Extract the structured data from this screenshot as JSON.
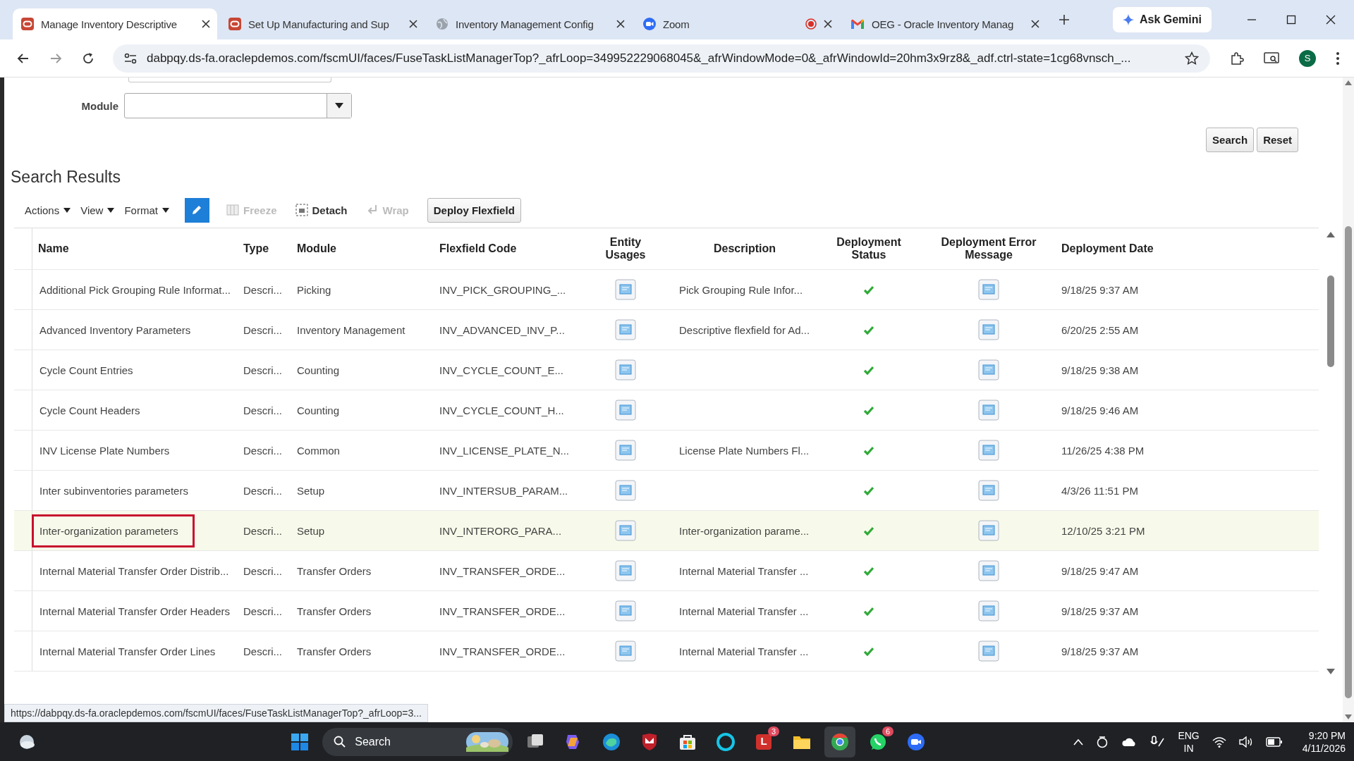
{
  "browser": {
    "tabs": [
      {
        "title": "Manage Inventory Descriptive",
        "kind": "oracle",
        "selected": true,
        "recording": false
      },
      {
        "title": "Set Up Manufacturing and Sup",
        "kind": "oracle",
        "selected": false,
        "recording": false
      },
      {
        "title": "Inventory Management Config",
        "kind": "globe",
        "selected": false,
        "recording": false
      },
      {
        "title": "Zoom",
        "kind": "zoom",
        "selected": false,
        "recording": true
      },
      {
        "title": "OEG - Oracle Inventory Manag",
        "kind": "gmail",
        "selected": false,
        "recording": false
      }
    ],
    "gemini": "Ask Gemini",
    "address": "dabpqy.ds-fa.oraclepdemos.com/fscmUI/faces/FuseTaskListManagerTop?_afrLoop=349952229068045&_afrWindowMode=0&_afrWindowId=20hm3x9rz8&_adf.ctrl-state=1cg68vnsch_...",
    "profile": "S"
  },
  "search_form": {
    "module_label": "Module",
    "buttons": [
      "Search",
      "Reset"
    ]
  },
  "results": {
    "title": "Search Results",
    "toolbar": [
      {
        "label": "Actions",
        "kind": "menu",
        "disabled": false
      },
      {
        "label": "View",
        "kind": "menu",
        "disabled": false
      },
      {
        "label": "Format",
        "kind": "menu",
        "disabled": false
      },
      {
        "kind": "edit",
        "disabled": false
      },
      {
        "label": "Freeze",
        "kind": "freeze",
        "disabled": true
      },
      {
        "label": "Detach",
        "kind": "detach",
        "disabled": false
      },
      {
        "label": "Wrap",
        "kind": "wrap",
        "disabled": true
      },
      {
        "label": "Deploy Flexfield",
        "kind": "button",
        "disabled": false
      }
    ],
    "columns": [
      "Name",
      "Type",
      "Module",
      "Flexfield Code",
      "Entity Usages",
      "Description",
      "Deployment Status",
      "Deployment Error Message",
      "Deployment Date"
    ],
    "rows": [
      {
        "name": "Additional Pick Grouping Rule Informat...",
        "type": "Descri...",
        "module": "Picking",
        "code": "INV_PICK_GROUPING_...",
        "description": "Pick Grouping Rule Infor...",
        "deployed": true,
        "date": "9/18/25 9:37 AM",
        "selected": false,
        "outlined": false
      },
      {
        "name": "Advanced Inventory Parameters",
        "type": "Descri...",
        "module": "Inventory Management",
        "code": "INV_ADVANCED_INV_P...",
        "description": "Descriptive flexfield for Ad...",
        "deployed": true,
        "date": "6/20/25 2:55 AM",
        "selected": false,
        "outlined": false
      },
      {
        "name": "Cycle Count Entries",
        "type": "Descri...",
        "module": "Counting",
        "code": "INV_CYCLE_COUNT_E...",
        "deployed": true,
        "date": "9/18/25 9:38 AM",
        "selected": false,
        "outlined": false
      },
      {
        "name": "Cycle Count Headers",
        "type": "Descri...",
        "module": "Counting",
        "code": "INV_CYCLE_COUNT_H...",
        "deployed": true,
        "date": "9/18/25 9:46 AM",
        "selected": false,
        "outlined": false
      },
      {
        "name": "INV License Plate Numbers",
        "type": "Descri...",
        "module": "Common",
        "code": "INV_LICENSE_PLATE_N...",
        "description": "License Plate Numbers Fl...",
        "deployed": true,
        "date": "11/26/25 4:38 PM",
        "selected": false,
        "outlined": false
      },
      {
        "name": "Inter subinventories parameters",
        "type": "Descri...",
        "module": "Setup",
        "code": "INV_INTERSUB_PARAM...",
        "deployed": true,
        "date": "4/3/26 11:51 PM",
        "selected": false,
        "outlined": false
      },
      {
        "name": "Inter-organization parameters",
        "type": "Descri...",
        "module": "Setup",
        "code": "INV_INTERORG_PARA...",
        "description": "Inter-organization parame...",
        "deployed": true,
        "date": "12/10/25 3:21 PM",
        "selected": true,
        "outlined": true
      },
      {
        "name": "Internal Material Transfer Order Distrib...",
        "type": "Descri...",
        "module": "Transfer Orders",
        "code": "INV_TRANSFER_ORDE...",
        "description": "Internal Material Transfer ...",
        "deployed": true,
        "date": "9/18/25 9:47 AM",
        "selected": false,
        "outlined": false
      },
      {
        "name": "Internal Material Transfer Order Headers",
        "type": "Descri...",
        "module": "Transfer Orders",
        "code": "INV_TRANSFER_ORDE...",
        "description": "Internal Material Transfer ...",
        "deployed": true,
        "date": "9/18/25 9:37 AM",
        "selected": false,
        "outlined": false
      },
      {
        "name": "Internal Material Transfer Order Lines",
        "type": "Descri...",
        "module": "Transfer Orders",
        "code": "INV_TRANSFER_ORDE...",
        "description": "Internal Material Transfer ...",
        "deployed": true,
        "date": "9/18/25 9:37 AM",
        "selected": false,
        "outlined": false
      }
    ]
  },
  "status_url": "https://dabpqy.ds-fa.oraclepdemos.com/fscmUI/faces/FuseTaskListManagerTop?_afrLoop=3...",
  "taskbar": {
    "search": "Search",
    "apps": [
      {
        "kind": "start",
        "selected": false
      },
      {
        "kind": "taskview",
        "selected": false
      },
      {
        "kind": "copilot",
        "selected": false
      },
      {
        "kind": "edge",
        "selected": false
      },
      {
        "kind": "shield",
        "selected": false
      },
      {
        "kind": "store",
        "selected": false
      },
      {
        "kind": "ring",
        "selected": false
      },
      {
        "kind": "letter",
        "letter": "L",
        "badge": "3",
        "selected": false
      },
      {
        "kind": "folder",
        "selected": false
      },
      {
        "kind": "chrome",
        "selected": true
      },
      {
        "kind": "chat",
        "badge": "6",
        "selected": false
      },
      {
        "kind": "camera",
        "selected": false
      }
    ],
    "language": [
      "ENG",
      "IN"
    ],
    "time": "9:20 PM",
    "date": "4/11/2026"
  }
}
